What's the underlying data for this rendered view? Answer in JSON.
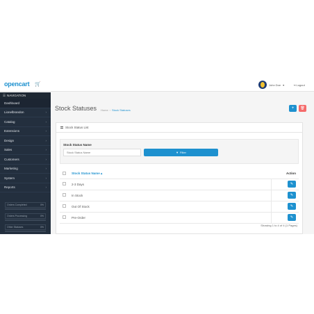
{
  "header": {
    "logo": "opencart",
    "logo_icon": "cart-icon",
    "user_name": "John Doe",
    "logout_label": "Logout"
  },
  "sidebar": {
    "title": "NAVIGATION",
    "items": [
      {
        "label": "Dashboard",
        "has_children": false
      },
      {
        "label": "Lionelbrandon",
        "has_children": true
      },
      {
        "label": "Catalog",
        "has_children": true
      },
      {
        "label": "Extensions",
        "has_children": true
      },
      {
        "label": "Design",
        "has_children": true
      },
      {
        "label": "Sales",
        "has_children": true
      },
      {
        "label": "Customers",
        "has_children": true
      },
      {
        "label": "Marketing",
        "has_children": true
      },
      {
        "label": "System",
        "has_children": true
      },
      {
        "label": "Reports",
        "has_children": true
      }
    ],
    "stats": [
      {
        "label": "Orders Completed",
        "value": "0%",
        "fraction": 0.0
      },
      {
        "label": "Orders Processing",
        "value": "0%",
        "fraction": 0.0
      },
      {
        "label": "Other Statuses",
        "value": "0%",
        "fraction": 0.0
      }
    ]
  },
  "page": {
    "title": "Stock Statuses",
    "breadcrumb": [
      "Home",
      "Stock Statuses"
    ],
    "add_icon": "plus-icon",
    "delete_icon": "trash-icon"
  },
  "panel": {
    "title": "Stock Status List",
    "filter": {
      "label": "Stock Status Name",
      "placeholder": "Stock Status Name",
      "button_label": "Filter"
    },
    "table": {
      "col_name": "Stock Status Name",
      "col_action": "Action",
      "rows": [
        "2-3 Days",
        "In Stock",
        "Out Of Stock",
        "Pre-Order"
      ]
    },
    "pagination_info": "Showing 1 to 4 of 4 (1 Pages)"
  },
  "colors": {
    "accent": "#1e91cf",
    "danger": "#f56b6b",
    "sidebar": "#232f3e"
  }
}
